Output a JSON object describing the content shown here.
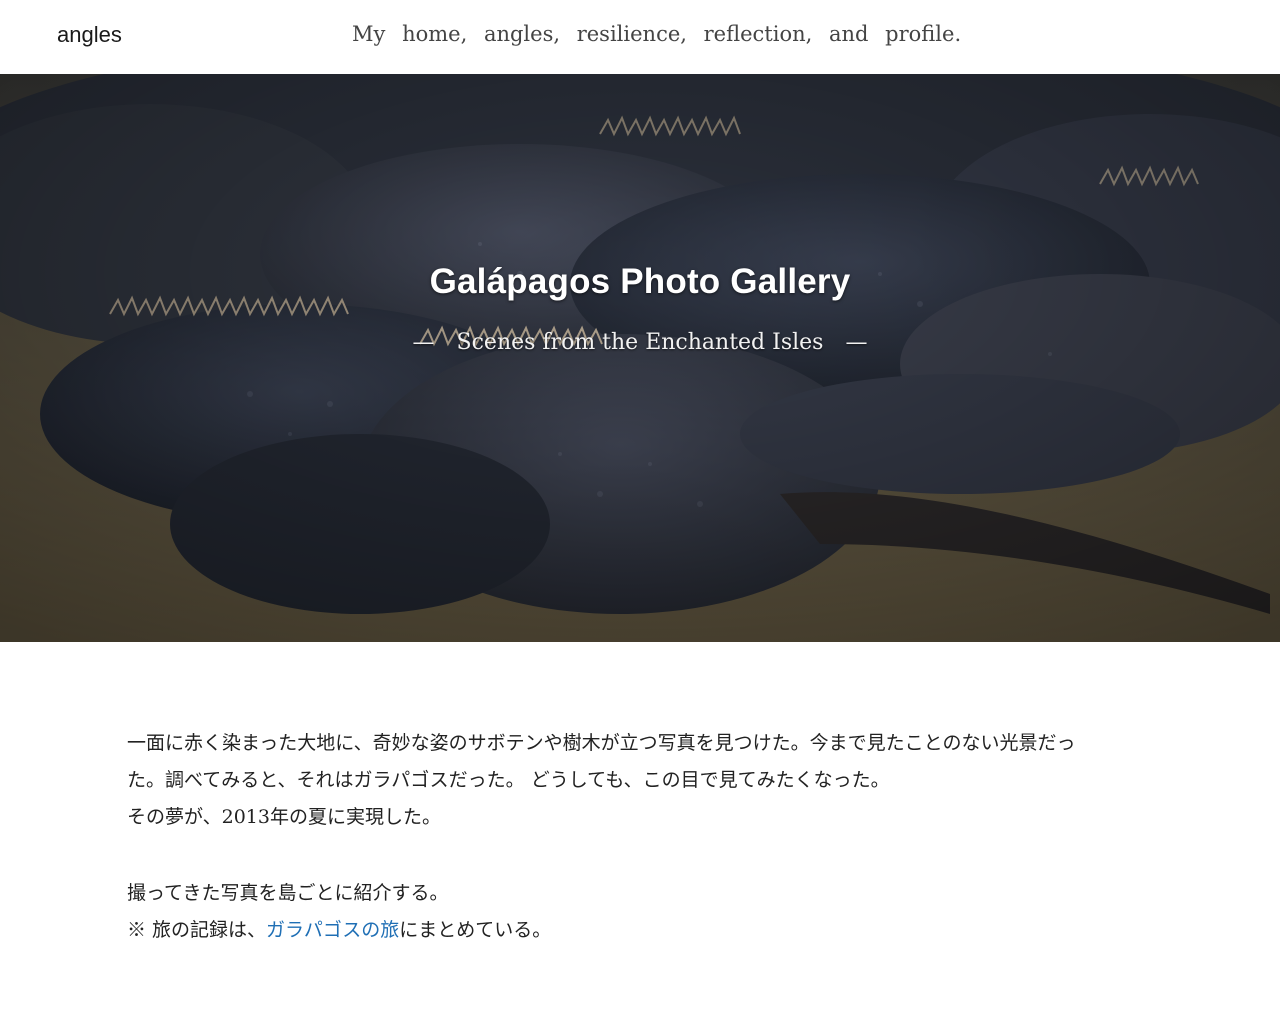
{
  "header": {
    "brand": "angles",
    "nav": [
      "My",
      "home,",
      "angles,",
      "resilience,",
      "reflection,",
      "and",
      "profile."
    ]
  },
  "hero": {
    "title": "Galápagos Photo Gallery",
    "subtitle": "Scenes from the Enchanted Isles",
    "dash": "—"
  },
  "content": {
    "para1_line1": "一面に赤く染まった大地に、奇妙な姿のサボテンや樹木が立つ写真を見つけた。今まで見たことのない光景だっ",
    "para1_line2": "た。調べてみると、それはガラパゴスだった。 どうしても、この目で見てみたくなった。",
    "para1_line3": "その夢が、2013年の夏に実現した。",
    "para2_line1": "撮ってきた写真を島ごとに紹介する。",
    "note_prefix": "※ 旅の記録は、",
    "note_link": "ガラパゴスの旅",
    "note_suffix": "にまとめている。"
  },
  "colors": {
    "link": "#1f6fb5",
    "iguana_dark": "#2a3140",
    "sand": "#6b5f44"
  }
}
